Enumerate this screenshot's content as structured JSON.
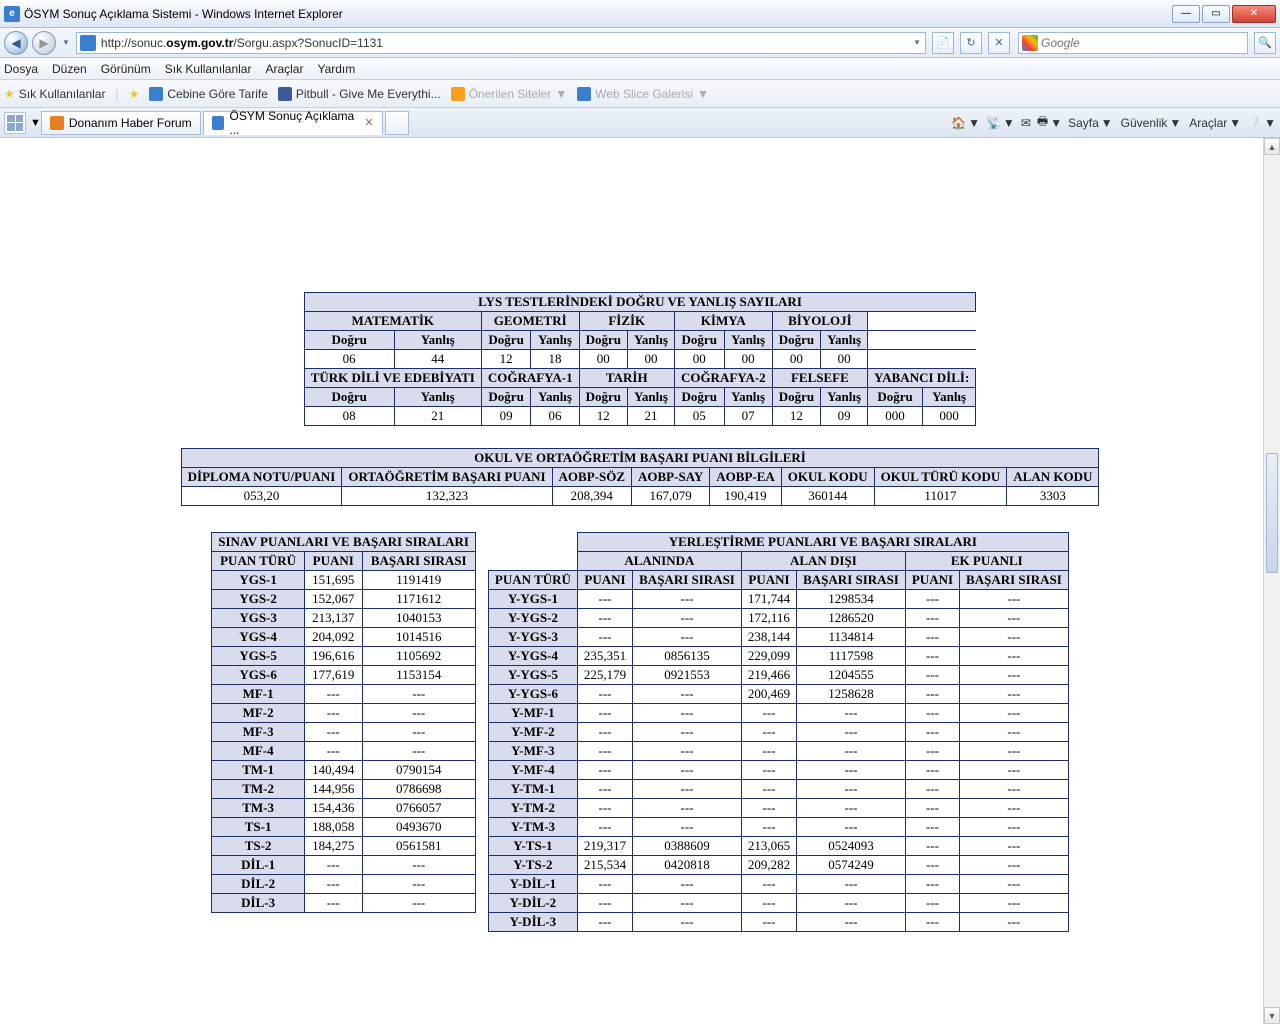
{
  "window": {
    "title": "ÖSYM Sonuç Açıklama Sistemi - Windows Internet Explorer"
  },
  "nav": {
    "url_pre": "http://sonuc.",
    "url_domain": "osym.gov.tr",
    "url_post": "/Sorgu.aspx?SonucID=1131",
    "search_placeholder": "Google"
  },
  "menu": [
    "Dosya",
    "Düzen",
    "Görünüm",
    "Sık Kullanılanlar",
    "Araçlar",
    "Yardım"
  ],
  "bookmarks": {
    "fav": "Sık Kullanılanlar",
    "items": [
      {
        "label": "Cebine Göre Tarife",
        "icon": "ie"
      },
      {
        "label": "Pitbull - Give Me Everythi...",
        "icon": "fb"
      },
      {
        "label": "Önerilen Siteler",
        "icon": "bulb",
        "faded": true,
        "drop": true
      },
      {
        "label": "Web Slice Galerisi",
        "icon": "ie",
        "faded": true,
        "drop": true
      }
    ]
  },
  "tabs": [
    {
      "label": "Donanım Haber Forum",
      "icon": "dh",
      "active": false
    },
    {
      "label": "ÖSYM Sonuç Açıklama ...",
      "icon": "ie",
      "active": true,
      "close": true
    }
  ],
  "cmd": [
    "Sayfa",
    "Güvenlik",
    "Araçlar"
  ],
  "lys": {
    "title": "LYS TESTLERİNDEKİ DOĞRU VE YANLIŞ SAYILARI",
    "row1_subjects": [
      "MATEMATİK",
      "GEOMETRİ",
      "FİZİK",
      "KİMYA",
      "BİYOLOJİ"
    ],
    "dy": {
      "d": "Doğru",
      "y": "Yanlış"
    },
    "row1_vals": [
      "06",
      "44",
      "12",
      "18",
      "00",
      "00",
      "00",
      "00",
      "00",
      "00"
    ],
    "row2_subjects": [
      "TÜRK DİLİ VE EDEBİYATI",
      "COĞRAFYA-1",
      "TARİH",
      "COĞRAFYA-2",
      "FELSEFE",
      "YABANCI DİLİ:"
    ],
    "row2_vals": [
      "08",
      "21",
      "09",
      "06",
      "12",
      "21",
      "05",
      "07",
      "12",
      "09",
      "000",
      "000"
    ]
  },
  "obp": {
    "title": "OKUL VE ORTAÖĞRETİM BAŞARI PUANI BİLGİLERİ",
    "headers": [
      "DİPLOMA NOTU/PUANI",
      "ORTAÖĞRETİM BAŞARI PUANI",
      "AOBP-SÖZ",
      "AOBP-SAY",
      "AOBP-EA",
      "OKUL KODU",
      "OKUL TÜRÜ KODU",
      "ALAN KODU"
    ],
    "vals": [
      "053,20",
      "132,323",
      "208,394",
      "167,079",
      "190,419",
      "360144",
      "11017",
      "3303"
    ]
  },
  "sinav": {
    "title": "SINAV PUANLARI VE BAŞARI SIRALARI",
    "headers": [
      "PUAN TÜRÜ",
      "PUANI",
      "BAŞARI SIRASI"
    ],
    "rows": [
      [
        "YGS-1",
        "151,695",
        "1191419"
      ],
      [
        "YGS-2",
        "152,067",
        "1171612"
      ],
      [
        "YGS-3",
        "213,137",
        "1040153"
      ],
      [
        "YGS-4",
        "204,092",
        "1014516"
      ],
      [
        "YGS-5",
        "196,616",
        "1105692"
      ],
      [
        "YGS-6",
        "177,619",
        "1153154"
      ],
      [
        "MF-1",
        "---",
        "---"
      ],
      [
        "MF-2",
        "---",
        "---"
      ],
      [
        "MF-3",
        "---",
        "---"
      ],
      [
        "MF-4",
        "---",
        "---"
      ],
      [
        "TM-1",
        "140,494",
        "0790154"
      ],
      [
        "TM-2",
        "144,956",
        "0786698"
      ],
      [
        "TM-3",
        "154,436",
        "0766057"
      ],
      [
        "TS-1",
        "188,058",
        "0493670"
      ],
      [
        "TS-2",
        "184,275",
        "0561581"
      ],
      [
        "DİL-1",
        "---",
        "---"
      ],
      [
        "DİL-2",
        "---",
        "---"
      ],
      [
        "DİL-3",
        "---",
        "---"
      ]
    ]
  },
  "yer": {
    "title": "YERLEŞTİRME PUANLARI VE BAŞARI SIRALARI",
    "group_headers": [
      "ALANINDA",
      "ALAN DIŞI",
      "EK PUANLI"
    ],
    "col0": "PUAN TÜRÜ",
    "sub": [
      "PUANI",
      "BAŞARI SIRASI"
    ],
    "rows": [
      [
        "Y-YGS-1",
        "---",
        "---",
        "171,744",
        "1298534",
        "---",
        "---"
      ],
      [
        "Y-YGS-2",
        "---",
        "---",
        "172,116",
        "1286520",
        "---",
        "---"
      ],
      [
        "Y-YGS-3",
        "---",
        "---",
        "238,144",
        "1134814",
        "---",
        "---"
      ],
      [
        "Y-YGS-4",
        "235,351",
        "0856135",
        "229,099",
        "1117598",
        "---",
        "---"
      ],
      [
        "Y-YGS-5",
        "225,179",
        "0921553",
        "219,466",
        "1204555",
        "---",
        "---"
      ],
      [
        "Y-YGS-6",
        "---",
        "---",
        "200,469",
        "1258628",
        "---",
        "---"
      ],
      [
        "Y-MF-1",
        "---",
        "---",
        "---",
        "---",
        "---",
        "---"
      ],
      [
        "Y-MF-2",
        "---",
        "---",
        "---",
        "---",
        "---",
        "---"
      ],
      [
        "Y-MF-3",
        "---",
        "---",
        "---",
        "---",
        "---",
        "---"
      ],
      [
        "Y-MF-4",
        "---",
        "---",
        "---",
        "---",
        "---",
        "---"
      ],
      [
        "Y-TM-1",
        "---",
        "---",
        "---",
        "---",
        "---",
        "---"
      ],
      [
        "Y-TM-2",
        "---",
        "---",
        "---",
        "---",
        "---",
        "---"
      ],
      [
        "Y-TM-3",
        "---",
        "---",
        "---",
        "---",
        "---",
        "---"
      ],
      [
        "Y-TS-1",
        "219,317",
        "0388609",
        "213,065",
        "0524093",
        "---",
        "---"
      ],
      [
        "Y-TS-2",
        "215,534",
        "0420818",
        "209,282",
        "0574249",
        "---",
        "---"
      ],
      [
        "Y-DİL-1",
        "---",
        "---",
        "---",
        "---",
        "---",
        "---"
      ],
      [
        "Y-DİL-2",
        "---",
        "---",
        "---",
        "---",
        "---",
        "---"
      ],
      [
        "Y-DİL-3",
        "---",
        "---",
        "---",
        "---",
        "---",
        "---"
      ]
    ]
  }
}
